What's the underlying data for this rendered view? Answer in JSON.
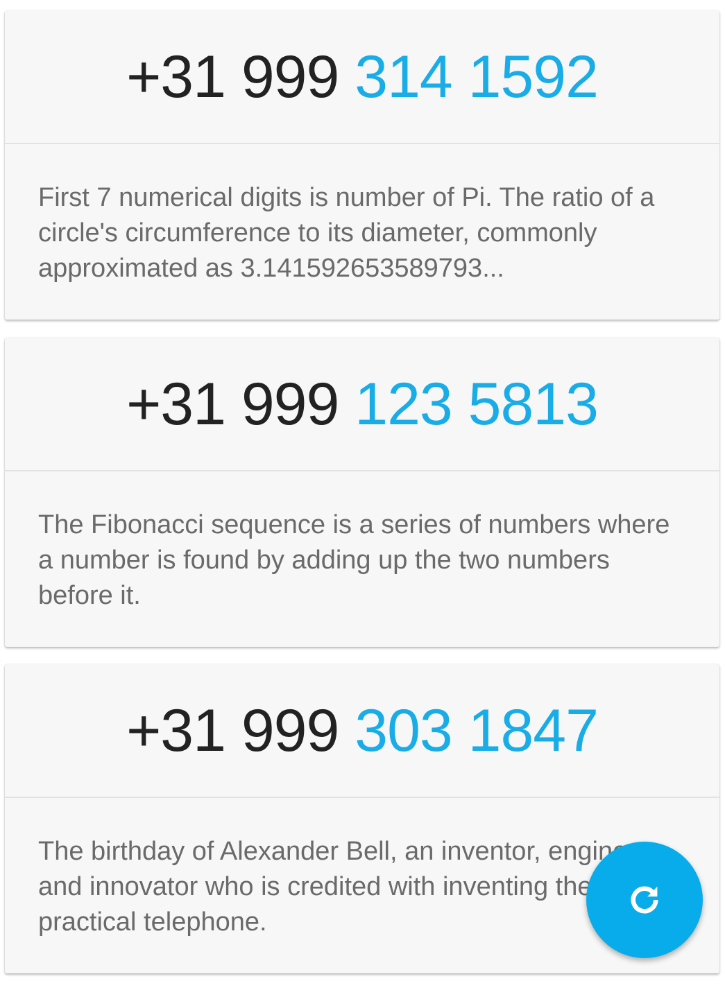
{
  "cards": [
    {
      "phone_prefix": "+31 999",
      "phone_highlight": "314 1592",
      "description": "First 7 numerical digits is number of Pi. The ratio of a circle's circumference to its diameter, commonly approximated as 3.141592653589793..."
    },
    {
      "phone_prefix": "+31 999",
      "phone_highlight": "123 5813",
      "description": "The Fibonacci sequence is a series of numbers where a number is found by adding up the two numbers before it."
    },
    {
      "phone_prefix": "+31 999",
      "phone_highlight": "303 1847",
      "description": "The birthday of Alexander Bell, an inventor, engineer and innovator who is credited with inventing the first practical telephone."
    }
  ],
  "fab": {
    "icon": "refresh-icon",
    "color": "#08aceb"
  },
  "colors": {
    "highlight": "#1aace6",
    "prefix": "#222222",
    "body_text": "#6a6a6a"
  }
}
